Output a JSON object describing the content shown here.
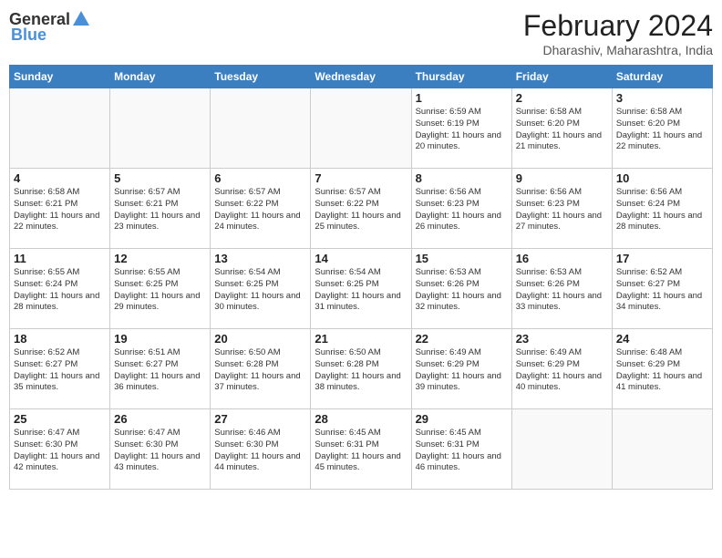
{
  "header": {
    "logo_general": "General",
    "logo_blue": "Blue",
    "month_year": "February 2024",
    "location": "Dharashiv, Maharashtra, India"
  },
  "days_of_week": [
    "Sunday",
    "Monday",
    "Tuesday",
    "Wednesday",
    "Thursday",
    "Friday",
    "Saturday"
  ],
  "weeks": [
    [
      {
        "day": "",
        "info": ""
      },
      {
        "day": "",
        "info": ""
      },
      {
        "day": "",
        "info": ""
      },
      {
        "day": "",
        "info": ""
      },
      {
        "day": "1",
        "info": "Sunrise: 6:59 AM\nSunset: 6:19 PM\nDaylight: 11 hours\nand 20 minutes."
      },
      {
        "day": "2",
        "info": "Sunrise: 6:58 AM\nSunset: 6:20 PM\nDaylight: 11 hours\nand 21 minutes."
      },
      {
        "day": "3",
        "info": "Sunrise: 6:58 AM\nSunset: 6:20 PM\nDaylight: 11 hours\nand 22 minutes."
      }
    ],
    [
      {
        "day": "4",
        "info": "Sunrise: 6:58 AM\nSunset: 6:21 PM\nDaylight: 11 hours\nand 22 minutes."
      },
      {
        "day": "5",
        "info": "Sunrise: 6:57 AM\nSunset: 6:21 PM\nDaylight: 11 hours\nand 23 minutes."
      },
      {
        "day": "6",
        "info": "Sunrise: 6:57 AM\nSunset: 6:22 PM\nDaylight: 11 hours\nand 24 minutes."
      },
      {
        "day": "7",
        "info": "Sunrise: 6:57 AM\nSunset: 6:22 PM\nDaylight: 11 hours\nand 25 minutes."
      },
      {
        "day": "8",
        "info": "Sunrise: 6:56 AM\nSunset: 6:23 PM\nDaylight: 11 hours\nand 26 minutes."
      },
      {
        "day": "9",
        "info": "Sunrise: 6:56 AM\nSunset: 6:23 PM\nDaylight: 11 hours\nand 27 minutes."
      },
      {
        "day": "10",
        "info": "Sunrise: 6:56 AM\nSunset: 6:24 PM\nDaylight: 11 hours\nand 28 minutes."
      }
    ],
    [
      {
        "day": "11",
        "info": "Sunrise: 6:55 AM\nSunset: 6:24 PM\nDaylight: 11 hours\nand 28 minutes."
      },
      {
        "day": "12",
        "info": "Sunrise: 6:55 AM\nSunset: 6:25 PM\nDaylight: 11 hours\nand 29 minutes."
      },
      {
        "day": "13",
        "info": "Sunrise: 6:54 AM\nSunset: 6:25 PM\nDaylight: 11 hours\nand 30 minutes."
      },
      {
        "day": "14",
        "info": "Sunrise: 6:54 AM\nSunset: 6:25 PM\nDaylight: 11 hours\nand 31 minutes."
      },
      {
        "day": "15",
        "info": "Sunrise: 6:53 AM\nSunset: 6:26 PM\nDaylight: 11 hours\nand 32 minutes."
      },
      {
        "day": "16",
        "info": "Sunrise: 6:53 AM\nSunset: 6:26 PM\nDaylight: 11 hours\nand 33 minutes."
      },
      {
        "day": "17",
        "info": "Sunrise: 6:52 AM\nSunset: 6:27 PM\nDaylight: 11 hours\nand 34 minutes."
      }
    ],
    [
      {
        "day": "18",
        "info": "Sunrise: 6:52 AM\nSunset: 6:27 PM\nDaylight: 11 hours\nand 35 minutes."
      },
      {
        "day": "19",
        "info": "Sunrise: 6:51 AM\nSunset: 6:27 PM\nDaylight: 11 hours\nand 36 minutes."
      },
      {
        "day": "20",
        "info": "Sunrise: 6:50 AM\nSunset: 6:28 PM\nDaylight: 11 hours\nand 37 minutes."
      },
      {
        "day": "21",
        "info": "Sunrise: 6:50 AM\nSunset: 6:28 PM\nDaylight: 11 hours\nand 38 minutes."
      },
      {
        "day": "22",
        "info": "Sunrise: 6:49 AM\nSunset: 6:29 PM\nDaylight: 11 hours\nand 39 minutes."
      },
      {
        "day": "23",
        "info": "Sunrise: 6:49 AM\nSunset: 6:29 PM\nDaylight: 11 hours\nand 40 minutes."
      },
      {
        "day": "24",
        "info": "Sunrise: 6:48 AM\nSunset: 6:29 PM\nDaylight: 11 hours\nand 41 minutes."
      }
    ],
    [
      {
        "day": "25",
        "info": "Sunrise: 6:47 AM\nSunset: 6:30 PM\nDaylight: 11 hours\nand 42 minutes."
      },
      {
        "day": "26",
        "info": "Sunrise: 6:47 AM\nSunset: 6:30 PM\nDaylight: 11 hours\nand 43 minutes."
      },
      {
        "day": "27",
        "info": "Sunrise: 6:46 AM\nSunset: 6:30 PM\nDaylight: 11 hours\nand 44 minutes."
      },
      {
        "day": "28",
        "info": "Sunrise: 6:45 AM\nSunset: 6:31 PM\nDaylight: 11 hours\nand 45 minutes."
      },
      {
        "day": "29",
        "info": "Sunrise: 6:45 AM\nSunset: 6:31 PM\nDaylight: 11 hours\nand 46 minutes."
      },
      {
        "day": "",
        "info": ""
      },
      {
        "day": "",
        "info": ""
      }
    ]
  ]
}
